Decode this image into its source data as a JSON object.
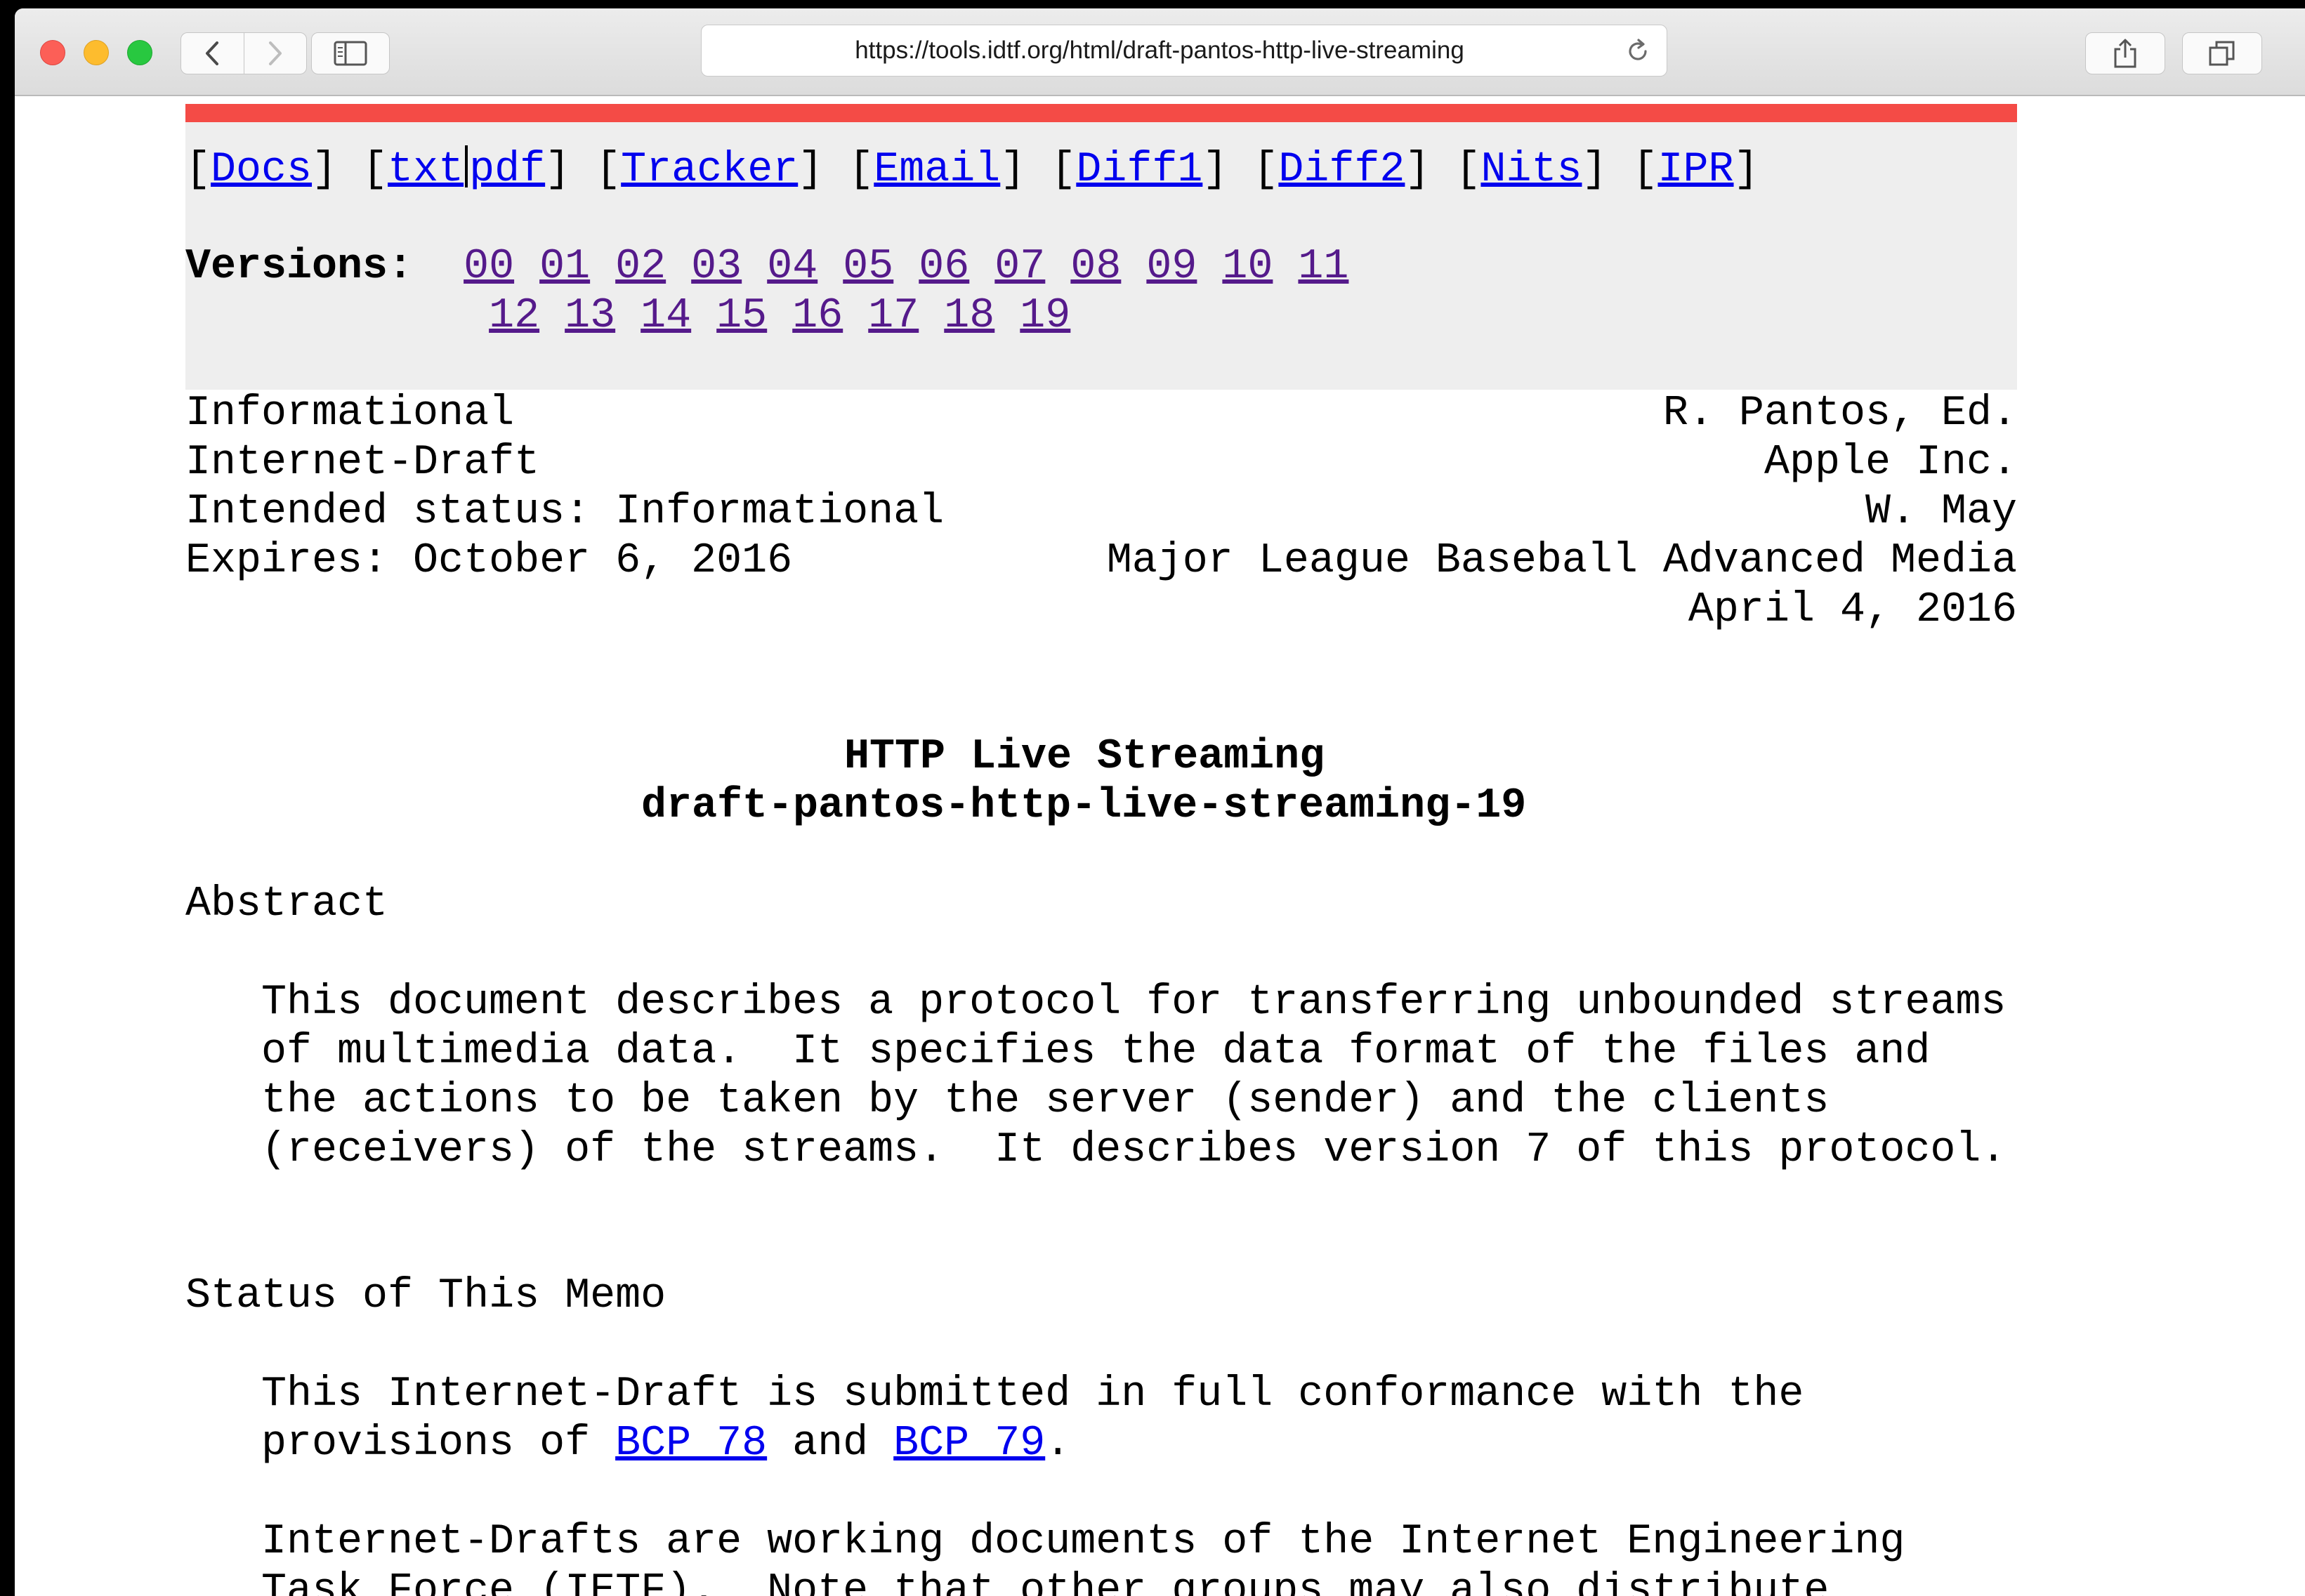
{
  "browser": {
    "url": "https://tools.idtf.org/html/draft-pantos-http-live-streaming"
  },
  "nav_links": {
    "docs": "Docs",
    "txt": "txt",
    "pdf": "pdf",
    "tracker": "Tracker",
    "email": "Email",
    "diff1": "Diff1",
    "diff2": "Diff2",
    "nits": "Nits",
    "ipr": "IPR"
  },
  "versions": {
    "label": "Versions:",
    "list": [
      "00",
      "01",
      "02",
      "03",
      "04",
      "05",
      "06",
      "07",
      "08",
      "09",
      "10",
      "11",
      "12",
      "13",
      "14",
      "15",
      "16",
      "17",
      "18",
      "19"
    ]
  },
  "header": {
    "left": [
      "Informational",
      "Internet-Draft",
      "Intended status: Informational",
      "Expires: October 6, 2016"
    ],
    "right": [
      "R. Pantos, Ed.",
      "Apple Inc.",
      "W. May",
      "Major League Baseball Advanced Media",
      "April 4, 2016"
    ]
  },
  "title": {
    "main": "HTTP Live Streaming",
    "draft": "draft-pantos-http-live-streaming-19"
  },
  "abstract": {
    "heading": "Abstract",
    "lines": [
      "This document describes a protocol for transferring unbounded streams",
      "of multimedia data.  It specifies the data format of the files and",
      "the actions to be taken by the server (sender) and the clients",
      "(receivers) of the streams.  It describes version 7 of this protocol."
    ]
  },
  "status_memo": {
    "heading": "Status of This Memo",
    "p1_line1": "This Internet-Draft is submitted in full conformance with the",
    "p1_line2_prefix": "provisions of ",
    "bcp78": "BCP 78",
    "p1_and": " and ",
    "bcp79": "BCP 79",
    "p1_end": ".",
    "p2_lines": [
      "Internet-Drafts are working documents of the Internet Engineering",
      "Task Force (IETF).  Note that other groups may also distribute"
    ]
  }
}
